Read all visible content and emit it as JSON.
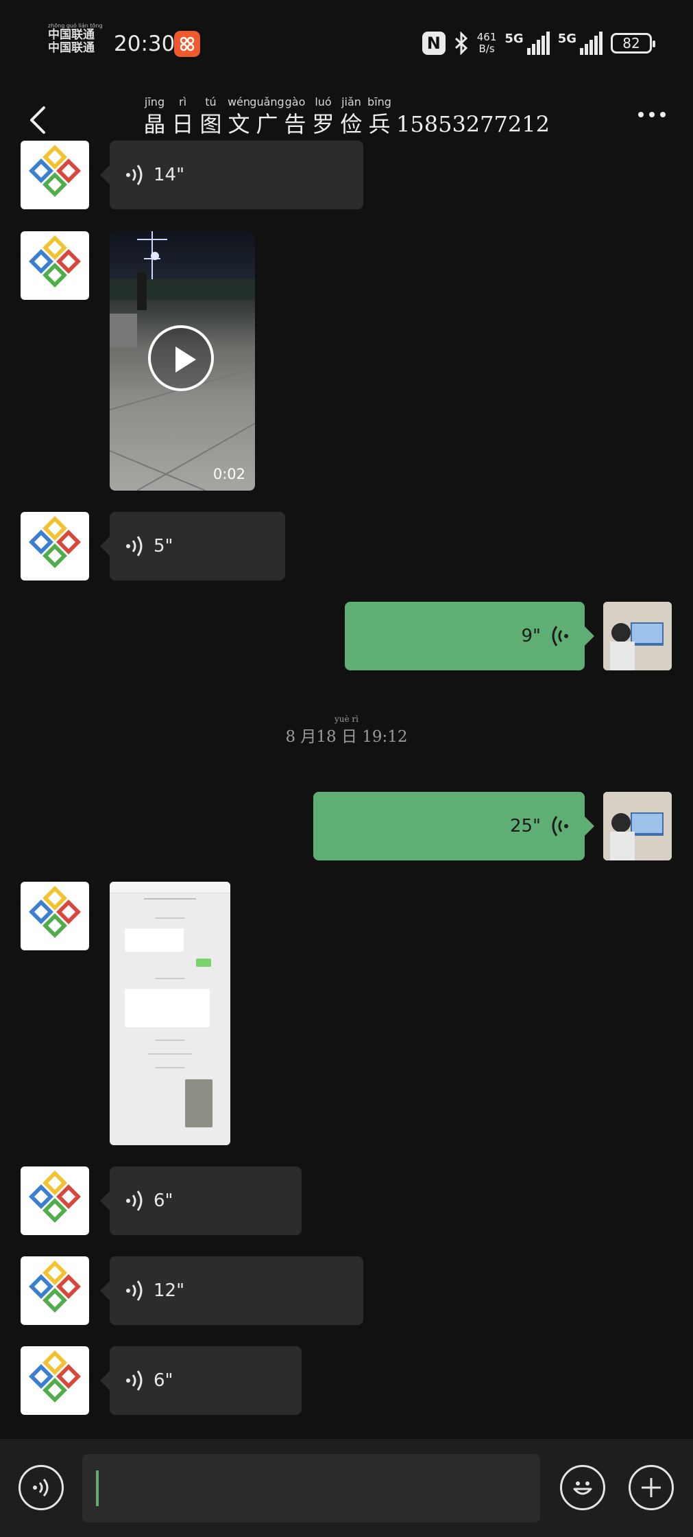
{
  "status_bar": {
    "carrier_line1": "中国联通",
    "carrier_line2": "中国联通",
    "carrier_pinyin": "zhōng guó lián tōng",
    "time": "20:30",
    "nfc": "N",
    "net_speed_value": "461",
    "net_speed_unit": "B/s",
    "signal1": "5G",
    "signal2": "5G",
    "battery": "82"
  },
  "header": {
    "title_chars": [
      {
        "py": "jīng",
        "hz": "晶"
      },
      {
        "py": "rì",
        "hz": "日"
      },
      {
        "py": "tú",
        "hz": "图"
      },
      {
        "py": "wén",
        "hz": "文"
      },
      {
        "py": "guǎng",
        "hz": "广"
      },
      {
        "py": "gào",
        "hz": "告"
      },
      {
        "py": "luó",
        "hz": "罗"
      },
      {
        "py": "jiǎn",
        "hz": "俭"
      },
      {
        "py": "bīng",
        "hz": "兵"
      }
    ],
    "title_number": "15853277212"
  },
  "messages": {
    "voice1": "14\"",
    "video_duration": "0:02",
    "voice2": "5\"",
    "voice_out1": "9\"",
    "timestamp_pinyin_yue": "yuè",
    "timestamp_pinyin_ri": "rì",
    "timestamp": "8 月18 日 19:12",
    "voice_out2": "25\"",
    "voice3": "6\"",
    "voice4": "12\"",
    "voice5": "6\""
  },
  "colors": {
    "background": "#111111",
    "incoming_bubble": "#2c2c2c",
    "outgoing_bubble": "#5fae73",
    "input_bar": "#1e1e1e"
  },
  "icons": [
    "back-arrow-icon",
    "more-icon",
    "voice-wave-icon",
    "play-icon",
    "voice-input-icon",
    "emoji-icon",
    "plus-icon",
    "bluetooth-icon",
    "nfc-icon",
    "battery-icon"
  ]
}
